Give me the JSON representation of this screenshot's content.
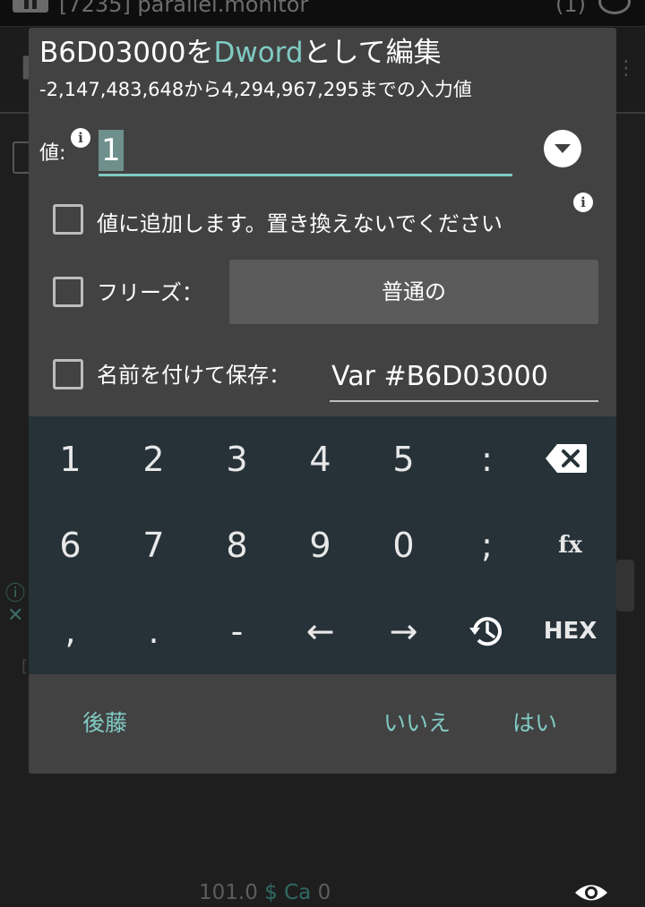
{
  "background": {
    "app_title": "[7235] parallel.monitor",
    "count": "(1)",
    "status": {
      "number": "101.0",
      "dollar": "$",
      "ca": "Ca",
      "ca_value": "0"
    }
  },
  "dialog": {
    "title_prefix": "B6D03000を",
    "title_accent": "Dword",
    "title_suffix": "として編集",
    "subtitle": "-2,147,483,648から4,294,967,295までの入力値",
    "value_label": "値:",
    "value": "1",
    "add_option_label": "値に追加します。置き換えないでください",
    "freeze_label": "フリーズ：",
    "freeze_value": "普通の",
    "save_name_label": "名前を付けて保存：",
    "save_name_value": "Var #B6D03000",
    "colors": {
      "accent": "#80cbc4",
      "dialog_bg": "#424242",
      "keypad_bg": "#263238"
    }
  },
  "keypad": {
    "row1": [
      "1",
      "2",
      "3",
      "4",
      "5",
      ":"
    ],
    "row2": [
      "6",
      "7",
      "8",
      "9",
      "0",
      ";",
      "fx"
    ],
    "row3": [
      ",",
      ".",
      "-",
      "←",
      "→"
    ],
    "hex": "HEX",
    "icons": [
      "backspace-icon",
      "history-icon"
    ]
  },
  "buttons": {
    "back": "後藤",
    "no": "いいえ",
    "yes": "はい"
  }
}
